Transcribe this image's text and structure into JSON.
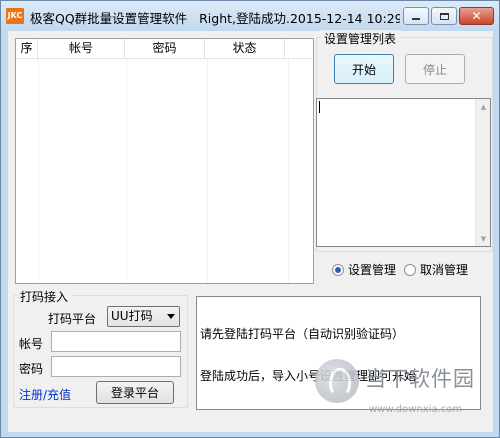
{
  "window": {
    "app_icon_text": "JKC",
    "title": "极客QQ群批量设置管理软件",
    "status": "Right,登陆成功.2015-12-14 10:29:..."
  },
  "table": {
    "columns": [
      "序",
      "帐号",
      "密码",
      "状态"
    ]
  },
  "settings_group": {
    "title": "设置管理列表",
    "start_label": "开始",
    "stop_label": "停止",
    "radio_set": "设置管理",
    "radio_cancel": "取消管理",
    "selected": "设置管理"
  },
  "captcha_group": {
    "title": "打码接入",
    "platform_label": "打码平台",
    "platform_value": "UU打码",
    "account_label": "帐号",
    "password_label": "密码",
    "register_link": "注册/充值",
    "login_label": "登录平台"
  },
  "log": {
    "lines": [
      "请先登陆打码平台（自动识别验证码）",
      "登陆成功后，导入小号设置管理即可开始"
    ]
  },
  "watermark": {
    "title": "当下软件园",
    "url": "www.downxia.com"
  },
  "colors": {
    "title_bar": "#c2d8ef",
    "client_bg": "#f0f0f0",
    "close_button": "#c9452e",
    "link": "#0033cc"
  }
}
